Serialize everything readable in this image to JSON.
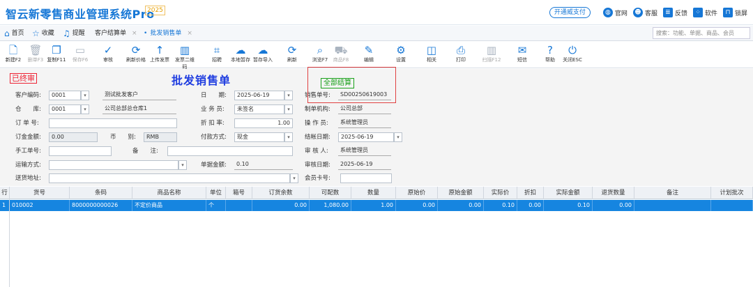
{
  "app": {
    "title": "智云新零售商业管理系统Pro",
    "version": "2025",
    "promo": "开通威支付",
    "links": [
      "官网",
      "客服",
      "反馈",
      "软件",
      "锁屏"
    ]
  },
  "tabs": {
    "home": "首页",
    "favorites": "收藏",
    "reminder": "提醒",
    "t1": "客户结算单",
    "t2": "批发销售单",
    "search_placeholder": "搜索：功能、单据、商品、会员"
  },
  "toolbar": [
    {
      "label": "新建F2",
      "icon": "new-doc-icon",
      "glyph": "🗋",
      "disabled": false
    },
    {
      "label": "删单F3",
      "icon": "trash-icon",
      "glyph": "🗑",
      "disabled": true
    },
    {
      "label": "复制F11",
      "icon": "copy-icon",
      "glyph": "❐",
      "disabled": false
    },
    {
      "label": "保存F6",
      "icon": "folder-icon",
      "glyph": "▭",
      "disabled": true
    },
    {
      "label": "审核",
      "icon": "check-circle-icon",
      "glyph": "✓",
      "disabled": false
    },
    {
      "label": "刷新价格",
      "icon": "refresh-icon",
      "glyph": "⟳",
      "disabled": false
    },
    {
      "label": "上传发票",
      "icon": "upload-icon",
      "glyph": "↑",
      "disabled": false
    },
    {
      "label": "发票二维码",
      "icon": "barcode-icon",
      "glyph": "▥",
      "disabled": false
    },
    {
      "label": "招聘",
      "icon": "qr-icon",
      "glyph": "⌗",
      "disabled": false
    },
    {
      "label": "本地暂存",
      "icon": "cloud-icon",
      "glyph": "☁",
      "disabled": false
    },
    {
      "label": "暂存导入",
      "icon": "cloud-import-icon",
      "glyph": "☁",
      "disabled": false
    },
    {
      "label": "刷新",
      "icon": "refresh-icon",
      "glyph": "⟳",
      "disabled": false
    },
    {
      "label": "浏览F7",
      "icon": "search-icon",
      "glyph": "⌕",
      "disabled": false
    },
    {
      "label": "商品F8",
      "icon": "cart-icon",
      "glyph": "⛟",
      "disabled": true
    },
    {
      "label": "编辑",
      "icon": "edit-icon",
      "glyph": "✎",
      "disabled": false
    },
    {
      "label": "设置",
      "icon": "gear-icon",
      "glyph": "⚙",
      "disabled": false
    },
    {
      "label": "相关",
      "icon": "related-icon",
      "glyph": "◫",
      "disabled": false
    },
    {
      "label": "打印",
      "icon": "printer-icon",
      "glyph": "⎙",
      "disabled": false
    },
    {
      "label": "扫描F12",
      "icon": "scan-icon",
      "glyph": "▥",
      "disabled": true
    },
    {
      "label": "短信",
      "icon": "sms-icon",
      "glyph": "✉",
      "disabled": false
    },
    {
      "label": "帮助",
      "icon": "help-icon",
      "glyph": "?",
      "disabled": false
    },
    {
      "label": "关闭ESC",
      "icon": "power-icon",
      "glyph": "⏻",
      "disabled": false
    }
  ],
  "form": {
    "doc_title": "批发销售单",
    "stamp": "已终审",
    "settled": "全部结算",
    "customer_code_label": "客户编码:",
    "customer_code": "0001",
    "customer_name": "测试批发客户",
    "date_label": "日　　期:",
    "date": "2025-06-19",
    "sale_no_label": "销售单号:",
    "sale_no": "SD00250619003",
    "warehouse_label": "仓　　库:",
    "warehouse_code": "0001",
    "warehouse_name": "公司总部总仓库1",
    "salesman_label": "业 务 员:",
    "salesman": "未签名",
    "org_label": "制单机构:",
    "org": "公司总部",
    "order_no_label": "订 单 号:",
    "discount_label": "折 扣 率:",
    "discount": "1.00",
    "operator_label": "操 作 员:",
    "operator": "系统管理员",
    "deposit_label": "订金金额:",
    "deposit": "0.00",
    "currency_label": "币　　别:",
    "currency": "RMB",
    "pay_label": "付款方式:",
    "pay": "现金",
    "settle_date_label": "结帐日期:",
    "settle_date": "2025-06-19",
    "manual_no_label": "手工单号:",
    "remark_label": "备　　注:",
    "auditor_label": "审 核 人:",
    "auditor": "系统管理员",
    "shipping_label": "运输方式:",
    "doc_amount_label": "单据金额:",
    "doc_amount": "0.10",
    "audit_date_label": "审核日期:",
    "audit_date": "2025-06-19",
    "address_label": "送货地址:",
    "member_label": "会员卡号:"
  },
  "grid": {
    "headers": [
      "行号",
      "货号",
      "条码",
      "商品名称",
      "单位",
      "箱号",
      "订货余数",
      "可配数",
      "数量",
      "原始价",
      "原始金额",
      "实际价",
      "折扣",
      "实际金额",
      "退货数量",
      "备注",
      "计划批次"
    ],
    "rows": [
      [
        "1",
        "010002",
        "8000000000026",
        "不定价商品",
        "个",
        "",
        "0.00",
        "1,080.00",
        "1.00",
        "0.00",
        "0.00",
        "0.10",
        "0.00",
        "0.10",
        "0.00",
        "",
        ""
      ]
    ]
  },
  "colors": {
    "accent": "#1677d6",
    "selected_row": "#1685e0",
    "stamp": "#e23333",
    "settled": "#18a018"
  }
}
